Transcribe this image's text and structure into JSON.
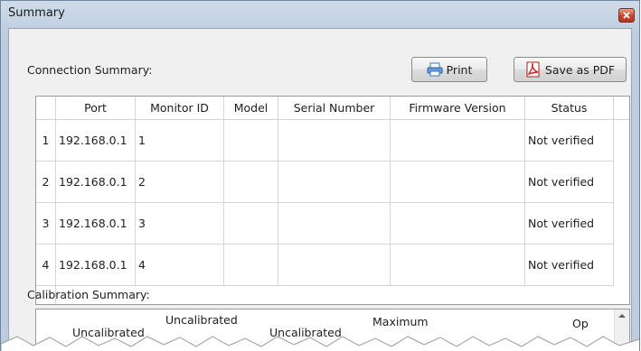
{
  "window": {
    "title": "Summary"
  },
  "connection": {
    "label": "Connection Summary:",
    "print_label": "Print",
    "pdf_label": "Save as PDF",
    "columns": [
      "Port",
      "Monitor ID",
      "Model",
      "Serial Number",
      "Firmware Version",
      "Status"
    ],
    "rows": [
      {
        "num": "1",
        "port": "192.168.0.1",
        "monitor_id": "1",
        "model": "",
        "serial": "",
        "firmware": "",
        "status": "Not verified"
      },
      {
        "num": "2",
        "port": "192.168.0.1",
        "monitor_id": "2",
        "model": "",
        "serial": "",
        "firmware": "",
        "status": "Not verified"
      },
      {
        "num": "3",
        "port": "192.168.0.1",
        "monitor_id": "3",
        "model": "",
        "serial": "",
        "firmware": "",
        "status": "Not verified"
      },
      {
        "num": "4",
        "port": "192.168.0.1",
        "monitor_id": "4",
        "model": "",
        "serial": "",
        "firmware": "",
        "status": "Not verified"
      }
    ]
  },
  "calibration": {
    "label": "Calibration Summary:",
    "partial_headers": [
      "Uncalibrated",
      "Uncalibrated",
      "Uncalibrated",
      "Maximum",
      "Op"
    ]
  },
  "colors": {
    "close": "#c4472e",
    "pdf_icon": "#d11f1f",
    "print_icon": "#3a78c4"
  }
}
